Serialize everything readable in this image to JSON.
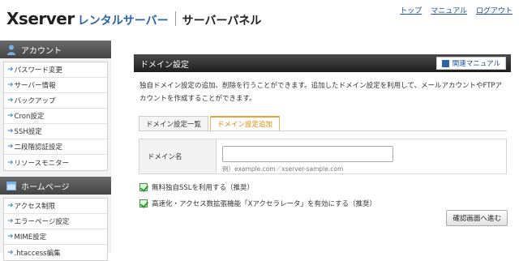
{
  "header": {
    "logo_main": "Xserver",
    "logo_sub": "レンタルサーバー",
    "panel_name": "サーバーパネル",
    "top_links": [
      "トップ",
      "マニュアル",
      "ログアウト"
    ]
  },
  "sidebar": {
    "account_heading": "アカウント",
    "account_items": [
      "パスワード変更",
      "サーバー情報",
      "バックアップ",
      "Cron設定",
      "SSH設定",
      "二段階認証設定",
      "リソースモニター"
    ],
    "homepage_heading": "ホームページ",
    "homepage_items": [
      "アクセス制限",
      "エラーページ設定",
      "MIME設定",
      ".htaccess編集"
    ]
  },
  "main": {
    "title": "ドメイン設定",
    "manual_button": "関連マニュアル",
    "description": "独自ドメイン設定の追加、削除を行うことができます。追加したドメイン設定を利用して、メールアカウントやFTPアカウントを作成することができます。",
    "tabs": [
      {
        "label": "ドメイン設定一覧",
        "active": false
      },
      {
        "label": "ドメイン設定追加",
        "active": true
      }
    ],
    "domain_label": "ドメイン名",
    "domain_value": "",
    "domain_example": "例）example.com／xserver-sample.com",
    "checkbox_ssl": "無料独自SSLを利用する（推奨）",
    "checkbox_accel": "高速化・アクセス数拡張機能「Xアクセラレータ」を有効にする（推奨）",
    "confirm_button": "確認画面へ進む"
  },
  "colors": {
    "brand_blue": "#2a63a8",
    "link_blue": "#1a4fa0",
    "active_tab_orange": "#e08a00",
    "check_green": "#2e9a2e"
  },
  "icons": {
    "account": "person-icon",
    "homepage": "browser-icon",
    "manual": "book-icon",
    "list_arrow": "arrow-right-icon"
  }
}
